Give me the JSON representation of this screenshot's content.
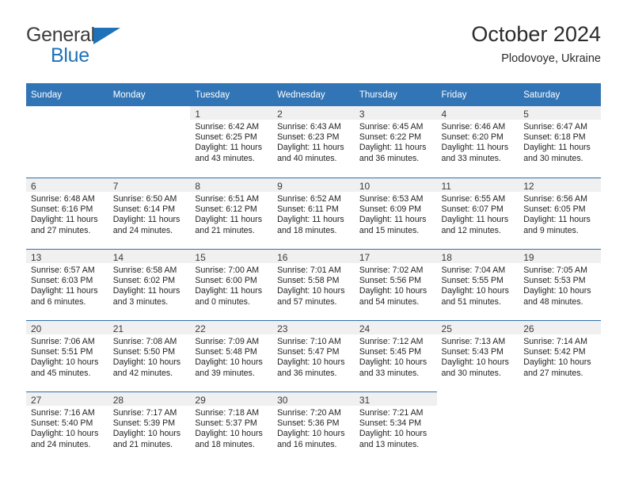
{
  "brand": {
    "name_top": "General",
    "name_bottom": "Blue",
    "triangle_icon": "triangle-icon",
    "color_dark": "#3c3c3c",
    "color_blue": "#1f72b8"
  },
  "header": {
    "title": "October 2024",
    "subtitle": "Plodovoye, Ukraine"
  },
  "theme": {
    "header_bg": "#3275b6",
    "daynum_band_bg": "#f0f0f0",
    "week_divider": "#2f6fae",
    "text": "#232323"
  },
  "weekday_headers": [
    "Sunday",
    "Monday",
    "Tuesday",
    "Wednesday",
    "Thursday",
    "Friday",
    "Saturday"
  ],
  "weeks": [
    [
      {
        "day": "",
        "lines": []
      },
      {
        "day": "",
        "lines": []
      },
      {
        "day": "1",
        "lines": [
          "Sunrise: 6:42 AM",
          "Sunset: 6:25 PM",
          "Daylight: 11 hours",
          "and 43 minutes."
        ]
      },
      {
        "day": "2",
        "lines": [
          "Sunrise: 6:43 AM",
          "Sunset: 6:23 PM",
          "Daylight: 11 hours",
          "and 40 minutes."
        ]
      },
      {
        "day": "3",
        "lines": [
          "Sunrise: 6:45 AM",
          "Sunset: 6:22 PM",
          "Daylight: 11 hours",
          "and 36 minutes."
        ]
      },
      {
        "day": "4",
        "lines": [
          "Sunrise: 6:46 AM",
          "Sunset: 6:20 PM",
          "Daylight: 11 hours",
          "and 33 minutes."
        ]
      },
      {
        "day": "5",
        "lines": [
          "Sunrise: 6:47 AM",
          "Sunset: 6:18 PM",
          "Daylight: 11 hours",
          "and 30 minutes."
        ]
      }
    ],
    [
      {
        "day": "6",
        "lines": [
          "Sunrise: 6:48 AM",
          "Sunset: 6:16 PM",
          "Daylight: 11 hours",
          "and 27 minutes."
        ]
      },
      {
        "day": "7",
        "lines": [
          "Sunrise: 6:50 AM",
          "Sunset: 6:14 PM",
          "Daylight: 11 hours",
          "and 24 minutes."
        ]
      },
      {
        "day": "8",
        "lines": [
          "Sunrise: 6:51 AM",
          "Sunset: 6:12 PM",
          "Daylight: 11 hours",
          "and 21 minutes."
        ]
      },
      {
        "day": "9",
        "lines": [
          "Sunrise: 6:52 AM",
          "Sunset: 6:11 PM",
          "Daylight: 11 hours",
          "and 18 minutes."
        ]
      },
      {
        "day": "10",
        "lines": [
          "Sunrise: 6:53 AM",
          "Sunset: 6:09 PM",
          "Daylight: 11 hours",
          "and 15 minutes."
        ]
      },
      {
        "day": "11",
        "lines": [
          "Sunrise: 6:55 AM",
          "Sunset: 6:07 PM",
          "Daylight: 11 hours",
          "and 12 minutes."
        ]
      },
      {
        "day": "12",
        "lines": [
          "Sunrise: 6:56 AM",
          "Sunset: 6:05 PM",
          "Daylight: 11 hours",
          "and 9 minutes."
        ]
      }
    ],
    [
      {
        "day": "13",
        "lines": [
          "Sunrise: 6:57 AM",
          "Sunset: 6:03 PM",
          "Daylight: 11 hours",
          "and 6 minutes."
        ]
      },
      {
        "day": "14",
        "lines": [
          "Sunrise: 6:58 AM",
          "Sunset: 6:02 PM",
          "Daylight: 11 hours",
          "and 3 minutes."
        ]
      },
      {
        "day": "15",
        "lines": [
          "Sunrise: 7:00 AM",
          "Sunset: 6:00 PM",
          "Daylight: 11 hours",
          "and 0 minutes."
        ]
      },
      {
        "day": "16",
        "lines": [
          "Sunrise: 7:01 AM",
          "Sunset: 5:58 PM",
          "Daylight: 10 hours",
          "and 57 minutes."
        ]
      },
      {
        "day": "17",
        "lines": [
          "Sunrise: 7:02 AM",
          "Sunset: 5:56 PM",
          "Daylight: 10 hours",
          "and 54 minutes."
        ]
      },
      {
        "day": "18",
        "lines": [
          "Sunrise: 7:04 AM",
          "Sunset: 5:55 PM",
          "Daylight: 10 hours",
          "and 51 minutes."
        ]
      },
      {
        "day": "19",
        "lines": [
          "Sunrise: 7:05 AM",
          "Sunset: 5:53 PM",
          "Daylight: 10 hours",
          "and 48 minutes."
        ]
      }
    ],
    [
      {
        "day": "20",
        "lines": [
          "Sunrise: 7:06 AM",
          "Sunset: 5:51 PM",
          "Daylight: 10 hours",
          "and 45 minutes."
        ]
      },
      {
        "day": "21",
        "lines": [
          "Sunrise: 7:08 AM",
          "Sunset: 5:50 PM",
          "Daylight: 10 hours",
          "and 42 minutes."
        ]
      },
      {
        "day": "22",
        "lines": [
          "Sunrise: 7:09 AM",
          "Sunset: 5:48 PM",
          "Daylight: 10 hours",
          "and 39 minutes."
        ]
      },
      {
        "day": "23",
        "lines": [
          "Sunrise: 7:10 AM",
          "Sunset: 5:47 PM",
          "Daylight: 10 hours",
          "and 36 minutes."
        ]
      },
      {
        "day": "24",
        "lines": [
          "Sunrise: 7:12 AM",
          "Sunset: 5:45 PM",
          "Daylight: 10 hours",
          "and 33 minutes."
        ]
      },
      {
        "day": "25",
        "lines": [
          "Sunrise: 7:13 AM",
          "Sunset: 5:43 PM",
          "Daylight: 10 hours",
          "and 30 minutes."
        ]
      },
      {
        "day": "26",
        "lines": [
          "Sunrise: 7:14 AM",
          "Sunset: 5:42 PM",
          "Daylight: 10 hours",
          "and 27 minutes."
        ]
      }
    ],
    [
      {
        "day": "27",
        "lines": [
          "Sunrise: 7:16 AM",
          "Sunset: 5:40 PM",
          "Daylight: 10 hours",
          "and 24 minutes."
        ]
      },
      {
        "day": "28",
        "lines": [
          "Sunrise: 7:17 AM",
          "Sunset: 5:39 PM",
          "Daylight: 10 hours",
          "and 21 minutes."
        ]
      },
      {
        "day": "29",
        "lines": [
          "Sunrise: 7:18 AM",
          "Sunset: 5:37 PM",
          "Daylight: 10 hours",
          "and 18 minutes."
        ]
      },
      {
        "day": "30",
        "lines": [
          "Sunrise: 7:20 AM",
          "Sunset: 5:36 PM",
          "Daylight: 10 hours",
          "and 16 minutes."
        ]
      },
      {
        "day": "31",
        "lines": [
          "Sunrise: 7:21 AM",
          "Sunset: 5:34 PM",
          "Daylight: 10 hours",
          "and 13 minutes."
        ]
      },
      {
        "day": "",
        "lines": []
      },
      {
        "day": "",
        "lines": []
      }
    ]
  ]
}
